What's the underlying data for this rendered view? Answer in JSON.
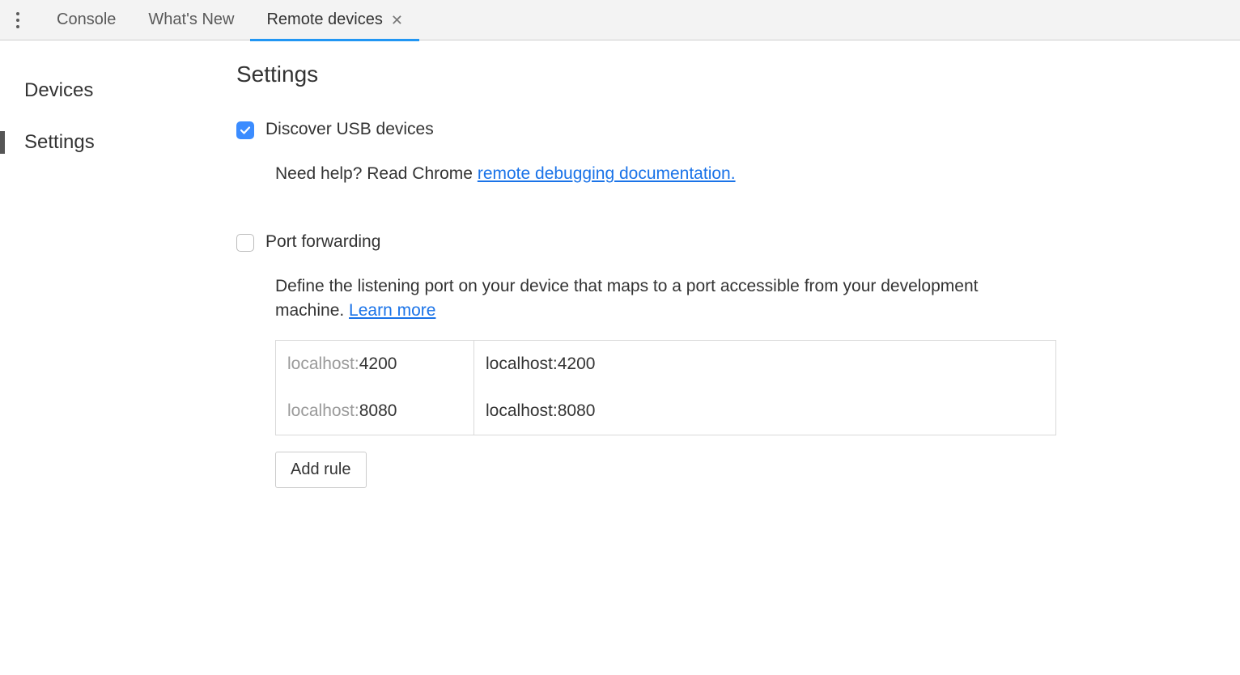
{
  "tabs": {
    "items": [
      {
        "label": "Console",
        "active": false,
        "closable": false
      },
      {
        "label": "What's New",
        "active": false,
        "closable": false
      },
      {
        "label": "Remote devices",
        "active": true,
        "closable": true
      }
    ]
  },
  "sidebar": {
    "items": [
      {
        "label": "Devices",
        "selected": false
      },
      {
        "label": "Settings",
        "selected": true
      }
    ]
  },
  "settings": {
    "title": "Settings",
    "discover": {
      "checked": true,
      "label": "Discover USB devices",
      "help_prefix": "Need help? Read Chrome ",
      "help_link": "remote debugging documentation."
    },
    "port_forwarding": {
      "checked": false,
      "label": "Port forwarding",
      "desc_prefix": "Define the listening port on your device that maps to a port accessible from your development machine. ",
      "learn_more": "Learn more",
      "rows": [
        {
          "left_muted": "localhost:",
          "left_val": "4200",
          "right": "localhost:4200"
        },
        {
          "left_muted": "localhost:",
          "left_val": "8080",
          "right": "localhost:8080"
        }
      ],
      "add_rule_label": "Add rule"
    }
  }
}
